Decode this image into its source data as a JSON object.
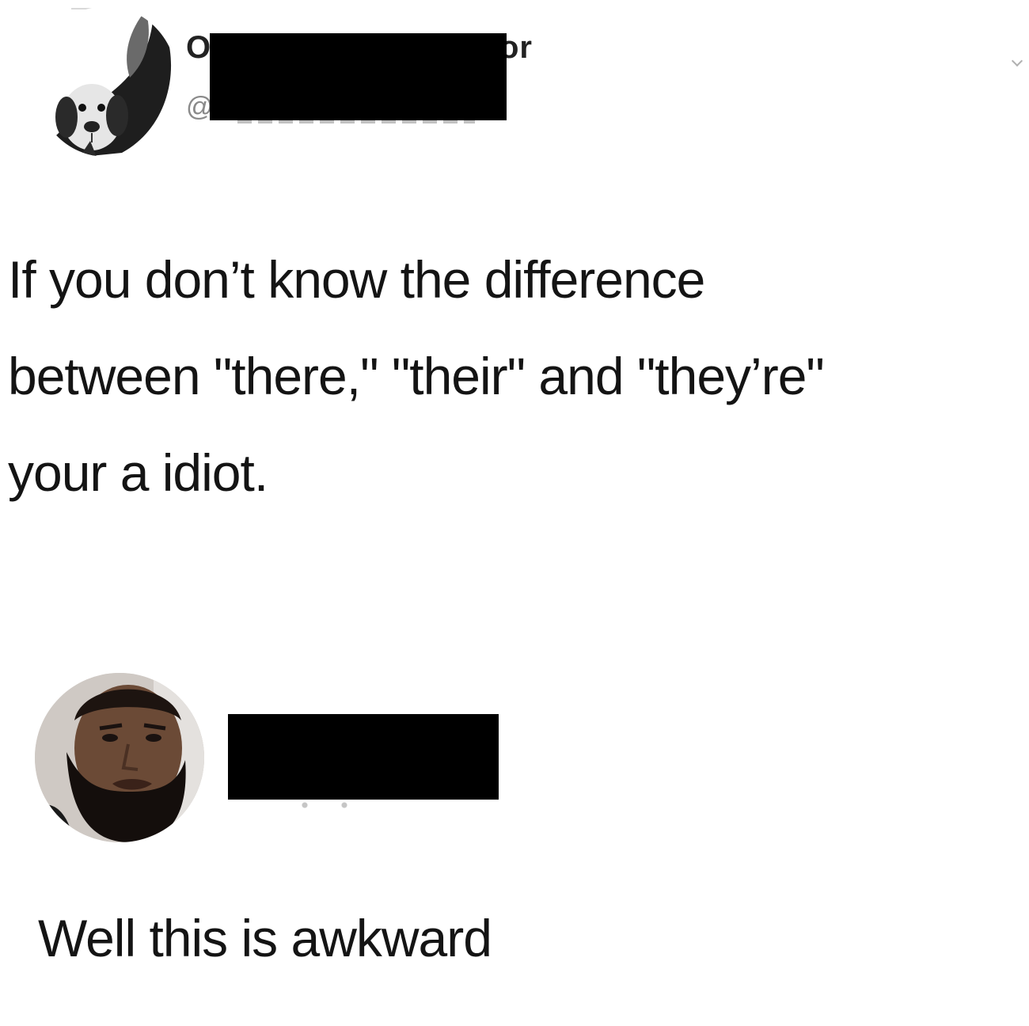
{
  "original_post": {
    "author": {
      "display_name_start": "O",
      "display_name_end": "or",
      "handle_prefix": "@",
      "avatar_icon": "dog-avatar",
      "name_redacted": true
    },
    "text_lines": [
      "If you don’t know the difference",
      "between \"there,\" \"their\" and \"they’re\"",
      "your a idiot."
    ]
  },
  "reply_post": {
    "author": {
      "avatar_icon": "bearded-man-avatar",
      "name_redacted": true
    },
    "text": "Well this is awkward"
  },
  "colors": {
    "background": "#ffffff",
    "text": "#141414",
    "handle": "#8a8a8a",
    "redaction": "#000000"
  }
}
